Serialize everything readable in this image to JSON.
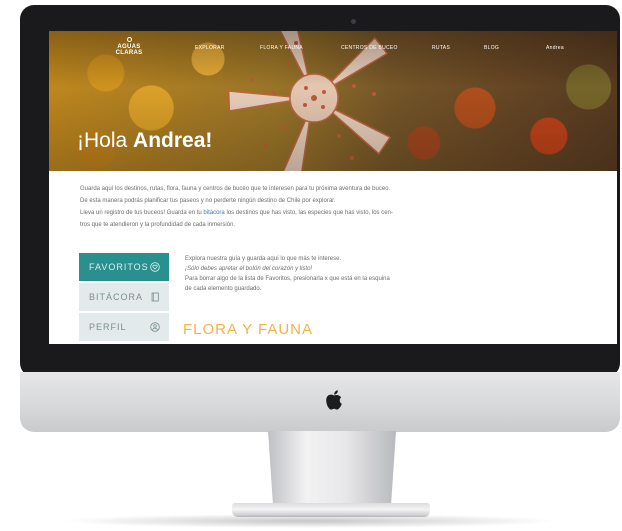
{
  "nav": {
    "logo_line1": "AGUAS",
    "logo_line2": "CLARAS",
    "links": [
      "EXPLORAR",
      "FLORA Y FAUNA",
      "CENTROS DE BUCEO",
      "RUTAS",
      "BLOG",
      "Andrea"
    ]
  },
  "hero": {
    "greeting": "¡Hola ",
    "name": "Andrea!"
  },
  "intro": {
    "p1": "Guarda aquí los destinos, rutas, flora, fauna y centros de buceo que te interesen para tu próxima aventura de buceo.",
    "p2": "De esta manera podrás planificar tus paseos y no perderte ningún destino de Chile por explorar.",
    "p3_a": "Lleva un registro de tus buceos! Guarda en tu ",
    "p3_link": "bitácora",
    "p3_b": " los destinos que has visto, las especies que has visto, los cen-",
    "p4": "tros que te atendieron y la profundidad de cada inmersión."
  },
  "menu": {
    "items": [
      {
        "label": "FAVORITOS",
        "icon": "heart-circle-icon",
        "active": true
      },
      {
        "label": "BITÁCORA",
        "icon": "book-icon",
        "active": false
      },
      {
        "label": "PERFIL",
        "icon": "user-circle-icon",
        "active": false
      }
    ]
  },
  "favorites": {
    "line1": "Explora nuestra guía y guarda aquí lo que más te interese.",
    "line2": "¡Sólo debes apretar el botón del corazón y listo!",
    "line3": "Para borrar algo de la lista de Favoritos, presionarla x que está en la esquina",
    "line4": "de cada elemento guardado."
  },
  "section": {
    "title": "FLORA Y FAUNA"
  },
  "colors": {
    "accent": "#2a8f8f",
    "menu_inactive": "#e3eaec",
    "section_title": "#f2b24a",
    "bezel": "#1a1a1c"
  }
}
